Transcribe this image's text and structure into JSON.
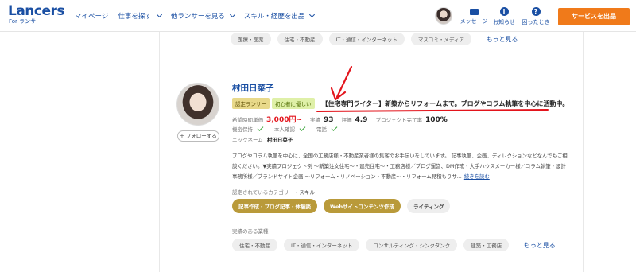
{
  "header": {
    "logo": "Lancers",
    "logo_sub": "For ランサー",
    "nav": [
      {
        "label": "マイページ",
        "dropdown": false
      },
      {
        "label": "仕事を探す",
        "dropdown": true
      },
      {
        "label": "他ランサーを見る",
        "dropdown": true
      },
      {
        "label": "スキル・経歴を出品",
        "dropdown": true
      }
    ],
    "messages_label": "メッセージ",
    "notifications_label": "お知らせ",
    "help_label": "困ったとき",
    "order_button": "サービスを出品"
  },
  "previous_card": {
    "industries": [
      "医療・医薬",
      "住宅・不動産",
      "IT・通信・インターネット",
      "マスコミ・メディア"
    ],
    "more_label": "もっと見る"
  },
  "profile": {
    "name": "村田日菜子",
    "follow_label": "+ フォローする",
    "badges": [
      "認定ランサー",
      "初心者に優しい"
    ],
    "catchphrase": "【住宅専門ライター】新築からリフォームまで。ブログやコラム執筆を中心に活動中。",
    "hourly_label": "希望時間単価",
    "hourly_value": "3,000円~",
    "achievements_label": "実績",
    "achievements_value": "93",
    "rating_label": "評価",
    "rating_value": "4.9",
    "completion_label": "プロジェクト完了率",
    "completion_value": "100%",
    "verifications": [
      "機密保持",
      "本人確認",
      "電話"
    ],
    "nickname_label": "ニックネーム",
    "nickname_value": "村田日菜子",
    "description_lines": [
      "ブログやコラム執筆を中心に、全国の工務店様・不動産業者様の集客のお手伝いをしています。 記事執筆、企画、ディレクションなどなんでもご相",
      "談ください。▼実績プロジェクト例 ～新築注文住宅～・建売住宅～・工務店様／ブログ運営、DM作成・大手ハウスメーカー様／コラム執筆・設計",
      "事務所様／ブランドサイト企画 ～リフォーム・リノベーション・不動産～・リフォーム見積もりサ..."
    ],
    "read_more": "続きを読む",
    "categories_title": "認定されているカテゴリー",
    "categories_suffix": "・スキル",
    "categories": [
      {
        "label": "記事作成・ブログ記事・体験談",
        "style": "gold"
      },
      {
        "label": "Webサイトコンテンツ作成",
        "style": "gold"
      },
      {
        "label": "ライティング",
        "style": "light"
      }
    ],
    "industries_title": "実績のある業種",
    "industries": [
      "住宅・不動産",
      "IT・通信・インターネット",
      "コンサルティング・シンクタンク",
      "建築・工務店"
    ],
    "more_label": "もっと見る"
  },
  "colors": {
    "brand": "#1a4fa3",
    "accent_orange": "#f07a1a",
    "price_red": "#e3141c",
    "annotation_red": "#e3141c",
    "gold_tag": "#b99a3a"
  }
}
